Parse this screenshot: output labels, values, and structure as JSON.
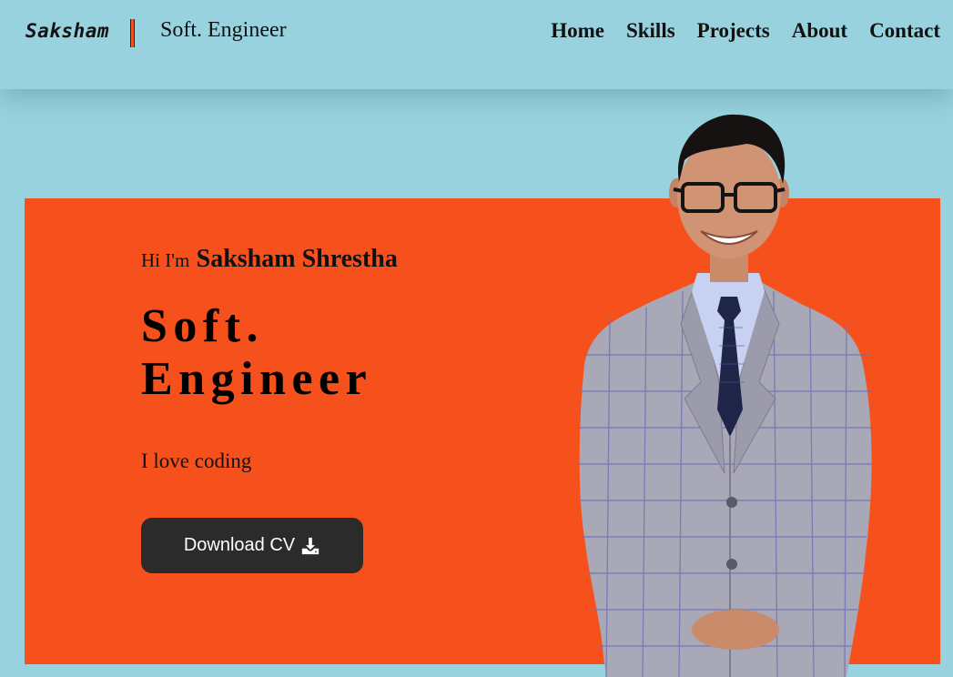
{
  "header": {
    "logo": "Saksham",
    "tagline": "Soft. Engineer",
    "nav": [
      "Home",
      "Skills",
      "Projects",
      "About",
      "Contact"
    ]
  },
  "hero": {
    "greeting": "Hi I'm",
    "name": "Saksham Shrestha",
    "role": "Soft. Engineer",
    "bio": "I love coding",
    "cv_button": "Download CV"
  },
  "colors": {
    "background": "#98d2de",
    "accent": "#f6511d",
    "button": "#2b2b2b"
  },
  "icons": {
    "download": "download-icon"
  }
}
